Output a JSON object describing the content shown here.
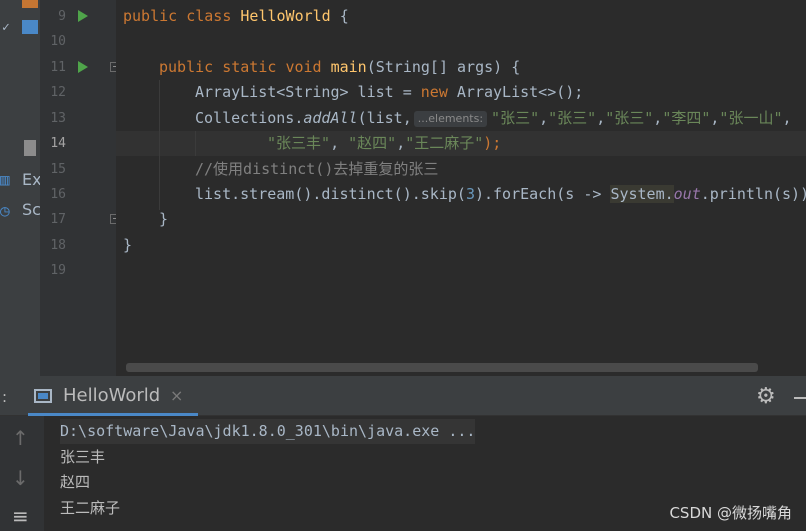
{
  "leftstrip": {
    "items": [
      {
        "label": "Ex"
      },
      {
        "label": "Sc"
      }
    ]
  },
  "gutter": {
    "line_numbers": [
      "9",
      "10",
      "11",
      "12",
      "13",
      "14",
      "15",
      "16",
      "17",
      "18",
      "19"
    ]
  },
  "code": {
    "l9": {
      "kw1": "public",
      "kw2": "class",
      "name": "HelloWorld",
      "brace": " {"
    },
    "l11": {
      "kw1": "public",
      "kw2": "static",
      "kw3": "void",
      "method": "main",
      "params": "(String[] args) {"
    },
    "l12": {
      "pre": "ArrayList<String> list = ",
      "kw": "new",
      "post": " ArrayList<>();"
    },
    "l13": {
      "pre": "Collections.",
      "method": "addAll",
      "args": "(list,",
      "hint": "...elements:",
      "s1": "\"张三\"",
      "s2": "\"张三\"",
      "s3": "\"张三\"",
      "s4": "\"李四\"",
      "s5": "\"张一山\"",
      "comma": ","
    },
    "l14": {
      "s1": "\"张三丰\"",
      "s2": "\"赵四\"",
      "s3": "\"王二麻子\"",
      "end": ");"
    },
    "l15": {
      "comment": "//使用distinct()去掉重复的张三"
    },
    "l16": {
      "pre": "list.stream().distinct().skip(",
      "num": "3",
      "mid": ").forEach(s -> ",
      "cls": "System.",
      "field": "out",
      "post": ".println(s))"
    },
    "l17": {
      "brace": "}"
    },
    "l18": {
      "brace": "}"
    }
  },
  "run_panel": {
    "colon": ":",
    "tab_title": "HelloWorld",
    "close_symbol": "×",
    "gear_symbol": "⚙",
    "command": "D:\\software\\Java\\jdk1.8.0_301\\bin\\java.exe ...",
    "output": [
      "张三丰",
      "赵四",
      "王二麻子"
    ]
  },
  "watermark": "CSDN @微扬嘴角",
  "colors": {
    "keyword": "#cc7832",
    "string": "#6a8759",
    "function": "#ffc66d",
    "run_icon": "#4fa44a",
    "tab_accent": "#4a88c7"
  }
}
